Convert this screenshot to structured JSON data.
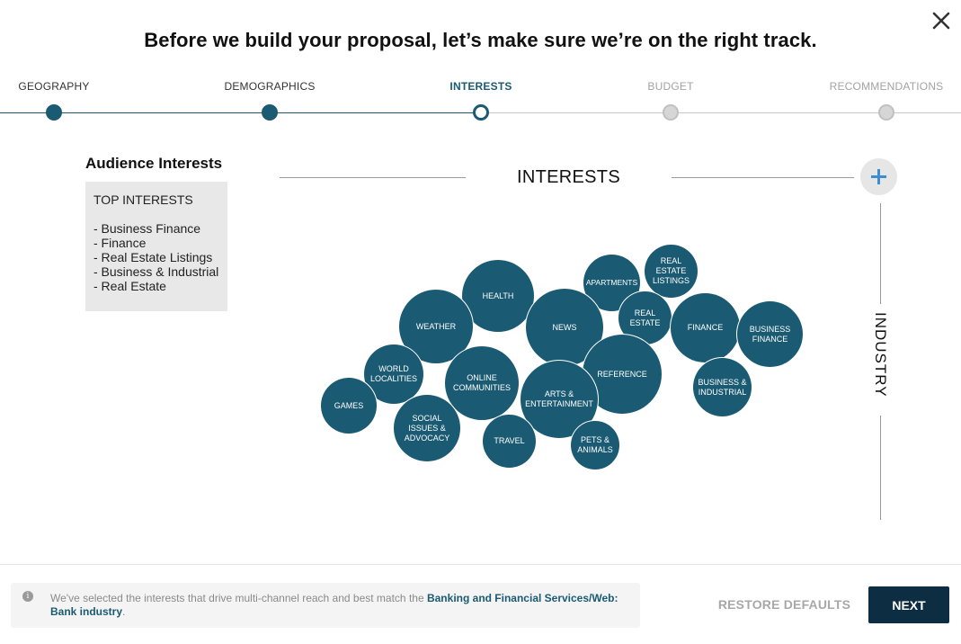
{
  "header": {
    "title": "Before we build your proposal, let’s make sure we’re on the right track.",
    "close_icon": "close-icon"
  },
  "stepper": {
    "steps": [
      {
        "label": "GEOGRAPHY",
        "state": "done"
      },
      {
        "label": "DEMOGRAPHICS",
        "state": "done"
      },
      {
        "label": "INTERESTS",
        "state": "active"
      },
      {
        "label": "BUDGET",
        "state": "future"
      },
      {
        "label": "RECOMMENDATIONS",
        "state": "future"
      }
    ]
  },
  "audience": {
    "title": "Audience Interests",
    "box_heading": "TOP INTERESTS",
    "top_interests": [
      "- Business Finance",
      "- Finance",
      "- Real Estate Listings",
      "- Business & Industrial",
      "- Real Estate"
    ]
  },
  "chart": {
    "x_axis_label": "INTERESTS",
    "y_axis_label": "INDUSTRY",
    "add_icon": "plus-icon"
  },
  "bubbles": [
    {
      "id": "health",
      "label": "HEALTH"
    },
    {
      "id": "apartments",
      "label": "APARTMENTS"
    },
    {
      "id": "real-estate-listings",
      "label": "REAL ESTATE LISTINGS"
    },
    {
      "id": "weather",
      "label": "WEATHER"
    },
    {
      "id": "news",
      "label": "NEWS"
    },
    {
      "id": "real-estate",
      "label": "REAL ESTATE"
    },
    {
      "id": "finance",
      "label": "FINANCE"
    },
    {
      "id": "business-finance",
      "label": "BUSINESS FINANCE"
    },
    {
      "id": "world-localities",
      "label": "WORLD LOCALITIES"
    },
    {
      "id": "online-communities",
      "label": "ONLINE COMMUNITIES"
    },
    {
      "id": "reference",
      "label": "REFERENCE"
    },
    {
      "id": "arts-entertainment",
      "label": "ARTS & ENTERTAINMENT"
    },
    {
      "id": "business-industrial",
      "label": "BUSINESS & INDUSTRIAL"
    },
    {
      "id": "games",
      "label": "GAMES"
    },
    {
      "id": "social-issues-advocacy",
      "label": "SOCIAL ISSUES & ADVOCACY"
    },
    {
      "id": "travel",
      "label": "TRAVEL"
    },
    {
      "id": "pets-animals",
      "label": "PETS & ANIMALS"
    }
  ],
  "footer": {
    "info_icon": "info-icon",
    "info_text_prefix": "We've selected the interests that drive multi-channel reach and best match the ",
    "info_text_highlight": "Banking and Financial Services/Web: Bank industry",
    "info_text_suffix": ".",
    "restore_label": "RESTORE DEFAULTS",
    "next_label": "NEXT"
  },
  "colors": {
    "accent": "#1a5a72",
    "next_button": "#0d2d42",
    "future_step": "#d6d6d6"
  }
}
